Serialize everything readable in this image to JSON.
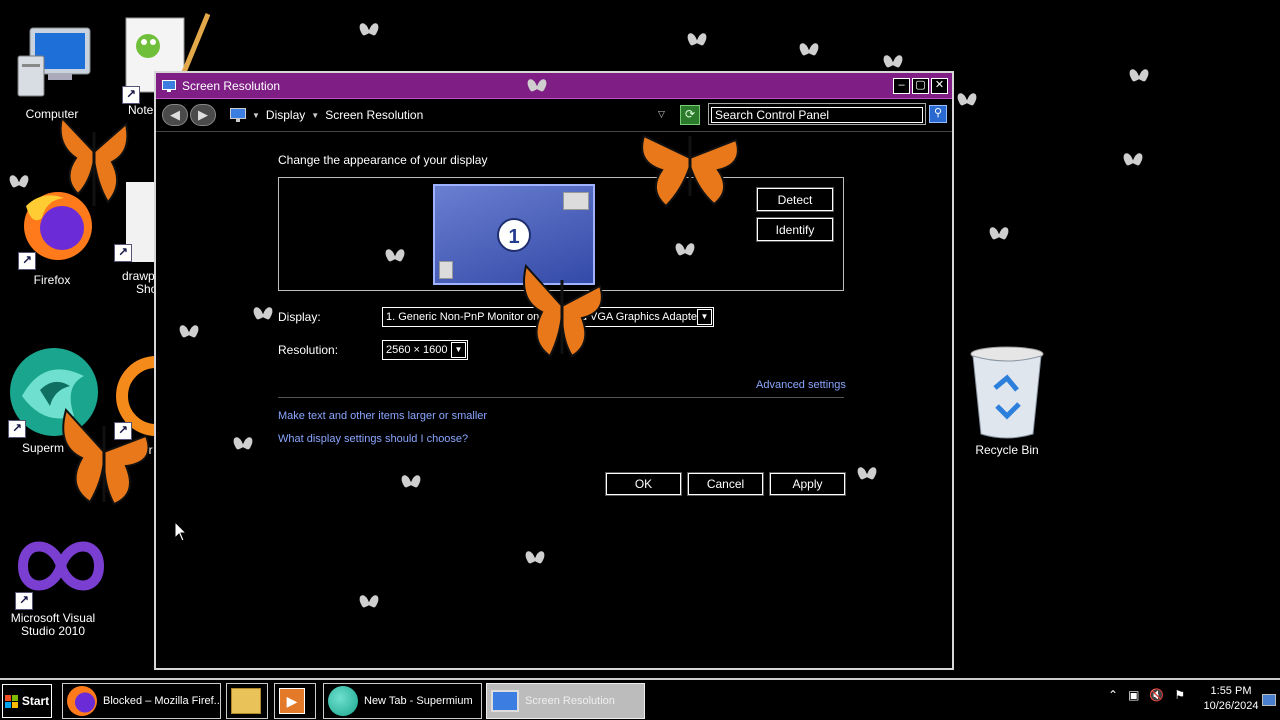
{
  "desktop": {
    "icons": [
      {
        "label": "Computer"
      },
      {
        "label": "Note"
      },
      {
        "label": "Firefox"
      },
      {
        "label": "drawp",
        "label2": "Sho"
      },
      {
        "label": "Superm"
      },
      {
        "label": "Ever"
      },
      {
        "label": "Microsoft Visual",
        "label2": "Studio 2010"
      },
      {
        "label": "Recycle Bin"
      }
    ]
  },
  "window": {
    "title": "Screen Resolution",
    "breadcrumb": [
      "Display",
      "Screen Resolution"
    ],
    "search_placeholder": "Search Control Panel",
    "heading": "Change the appearance of your display",
    "monitor_number": "1",
    "detect_label": "Detect",
    "identify_label": "Identify",
    "display_label": "Display:",
    "display_value": "1. Generic Non-PnP Monitor on Standard VGA Graphics Adapter",
    "resolution_label": "Resolution:",
    "resolution_value": "2560 × 1600",
    "advanced_link": "Advanced settings",
    "link_text_size": "Make text and other items larger or smaller",
    "link_which_settings": "What display settings should I choose?",
    "ok_label": "OK",
    "cancel_label": "Cancel",
    "apply_label": "Apply"
  },
  "taskbar": {
    "start_label": "Start",
    "items": [
      {
        "label": "Blocked – Mozilla Firef..."
      },
      {
        "label": ""
      },
      {
        "label": ""
      },
      {
        "label": "New Tab - Supermium"
      },
      {
        "label": "Screen Resolution"
      }
    ],
    "clock_time": "1:55 PM",
    "clock_date": "10/26/2024"
  },
  "colors": {
    "title_bar": "#7f1f86",
    "link": "#8aa6ff",
    "butterfly": "#e8781a"
  }
}
